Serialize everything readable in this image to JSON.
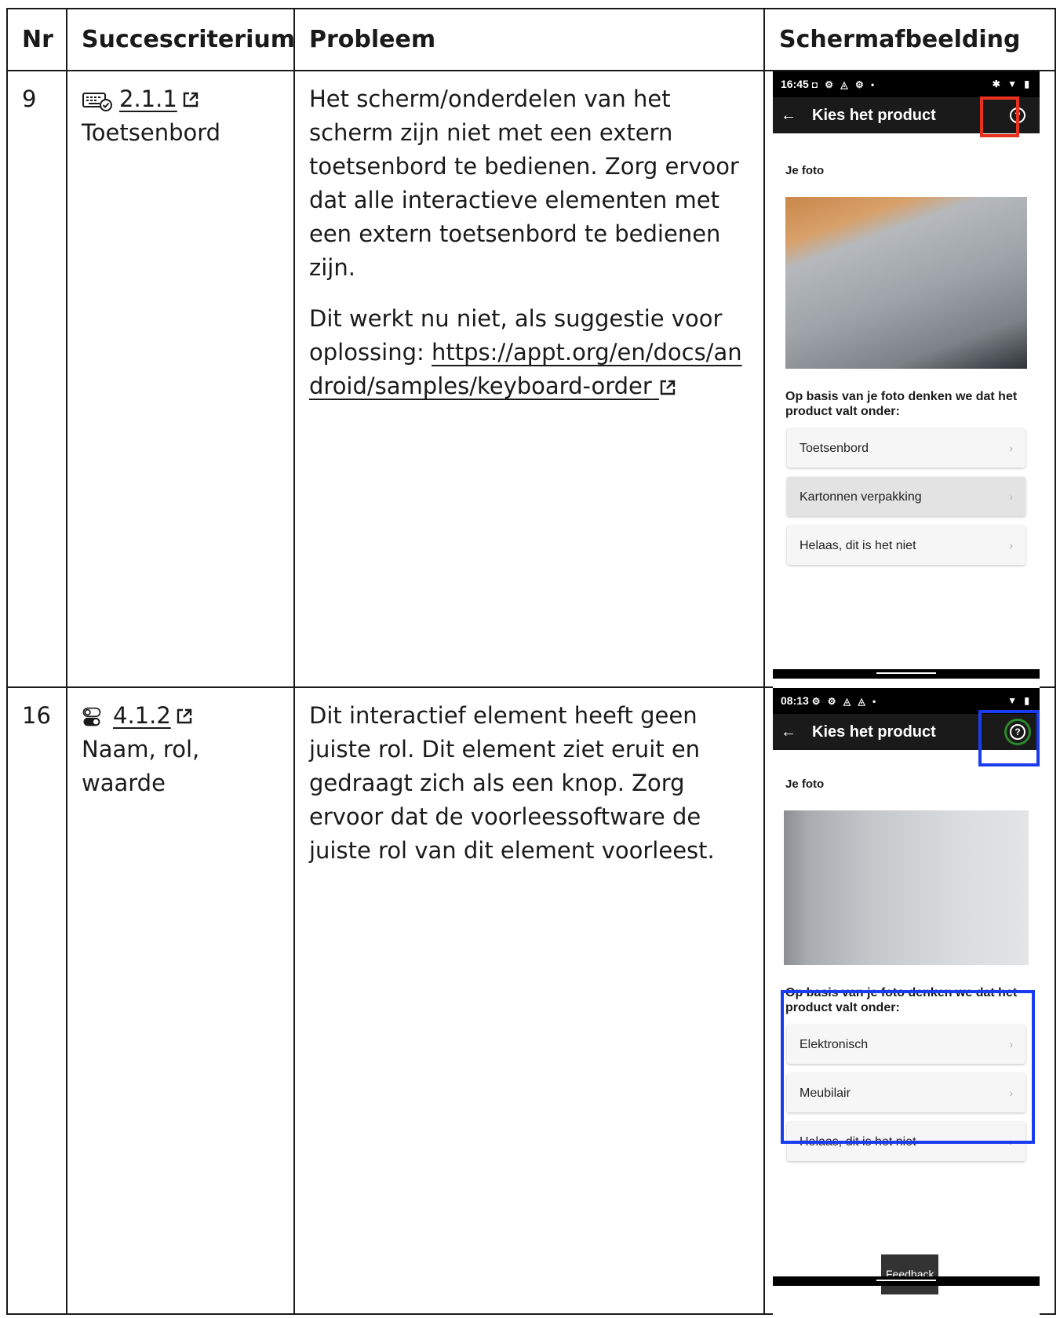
{
  "headers": {
    "nr": "Nr",
    "criterion": "Succescriterium",
    "problem": "Probleem",
    "screenshot": "Schermafbeelding"
  },
  "rows": [
    {
      "nr": "9",
      "criterion_icon": "keyboard-icon",
      "criterion_number": "2.1.1",
      "criterion_name": "Toetsenbord",
      "problem_paragraphs": [
        "Het scherm/onderdelen van het scherm zijn niet met een extern toetsenbord te bedienen. Zorg ervoor dat alle interactieve elementen met een extern toetsenbord te bedienen zijn."
      ],
      "suggestion_text": "Dit werkt nu niet, als suggestie voor oplossing: ",
      "suggestion_link": "https://appt.org/en/docs/android/samples/keyboard-order",
      "phone": {
        "time": "16:45",
        "status_icons_left": "◘ ⚙ ◬ ⚙ •",
        "status_icons_right": "✱ ▼ ▮",
        "back": "←",
        "title": "Kies het product",
        "help": "?",
        "je_foto": "Je foto",
        "basis_text": "Op basis van je foto denken we dat het product valt onder:",
        "options": [
          "Toetsenbord",
          "Kartonnen verpakking",
          "Helaas, dit is het niet"
        ],
        "chevron": "›",
        "highlight_colors": [
          "#e8321e"
        ]
      }
    },
    {
      "nr": "16",
      "criterion_icon": "toggle-icon",
      "criterion_number": "4.1.2",
      "criterion_name": "Naam, rol, waarde",
      "problem_paragraphs": [
        "Dit interactief element heeft geen juiste rol. Dit element ziet eruit en gedraagt zich als een knop. Zorg ervoor dat de voorleessoftware de juiste rol van dit element voorleest."
      ],
      "phone": {
        "time": "08:13",
        "status_icons_left": "⚙ ⚙ ◬ ◬ •",
        "status_icons_right": "▼ ▮",
        "back": "←",
        "title": "Kies het product",
        "help": "?",
        "je_foto": "Je foto",
        "basis_text": "Op basis van je foto denken we dat het product valt onder:",
        "options": [
          "Elektronisch",
          "Meubilair",
          "Helaas, dit is het niet"
        ],
        "chevron": "›",
        "feedback": "Feedback",
        "highlight_colors": [
          "#1a3cf0",
          "#2a8a2a"
        ]
      }
    }
  ]
}
